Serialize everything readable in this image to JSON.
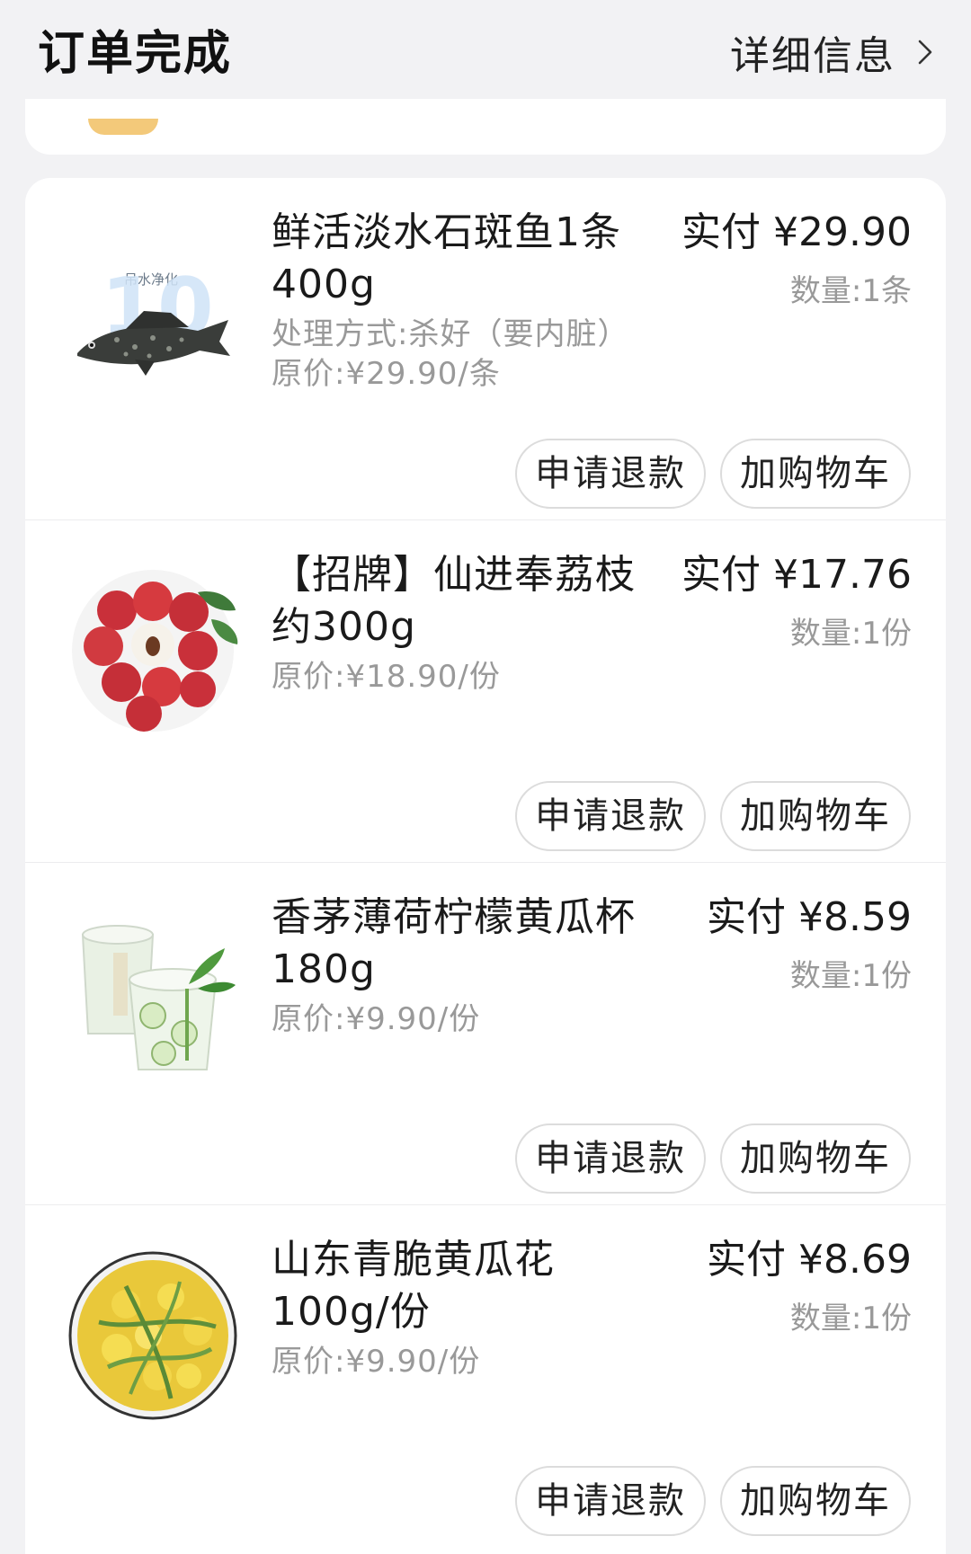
{
  "header": {
    "status_title": "订单完成",
    "detail_link_label": "详细信息",
    "detail_icon": "chevron-right-icon"
  },
  "products": [
    {
      "image_icon": "grouper-fish-image",
      "image_badge_text": "吊水净化",
      "name": "鲜活淡水石斑鱼1条400g",
      "meta_lines": [
        "处理方式:杀好（要内脏）",
        "原价:¥29.90/条"
      ],
      "paid": "实付 ¥29.90",
      "quantity": "数量:1条",
      "refund_label": "申请退款",
      "add_cart_label": "加购物车"
    },
    {
      "image_icon": "lychee-image",
      "name": "【招牌】仙进奉荔枝约300g",
      "meta_lines": [
        "原价:¥18.90/份"
      ],
      "paid": "实付 ¥17.76",
      "quantity": "数量:1份",
      "refund_label": "申请退款",
      "add_cart_label": "加购物车"
    },
    {
      "image_icon": "cucumber-drink-cup-image",
      "name": "香茅薄荷柠檬黄瓜杯180g",
      "meta_lines": [
        "原价:¥9.90/份"
      ],
      "paid": "实付 ¥8.59",
      "quantity": "数量:1份",
      "refund_label": "申请退款",
      "add_cart_label": "加购物车"
    },
    {
      "image_icon": "cucumber-flower-image",
      "name": "山东青脆黄瓜花100g/份",
      "meta_lines": [
        "原价:¥9.90/份"
      ],
      "paid": "实付 ¥8.69",
      "quantity": "数量:1份",
      "refund_label": "申请退款",
      "add_cart_label": "加购物车"
    }
  ],
  "colors": {
    "background": "#f2f2f4",
    "card": "#ffffff",
    "primary_text": "#1a1a1a",
    "secondary_text": "#999999",
    "button_border": "#dcdcdc"
  }
}
